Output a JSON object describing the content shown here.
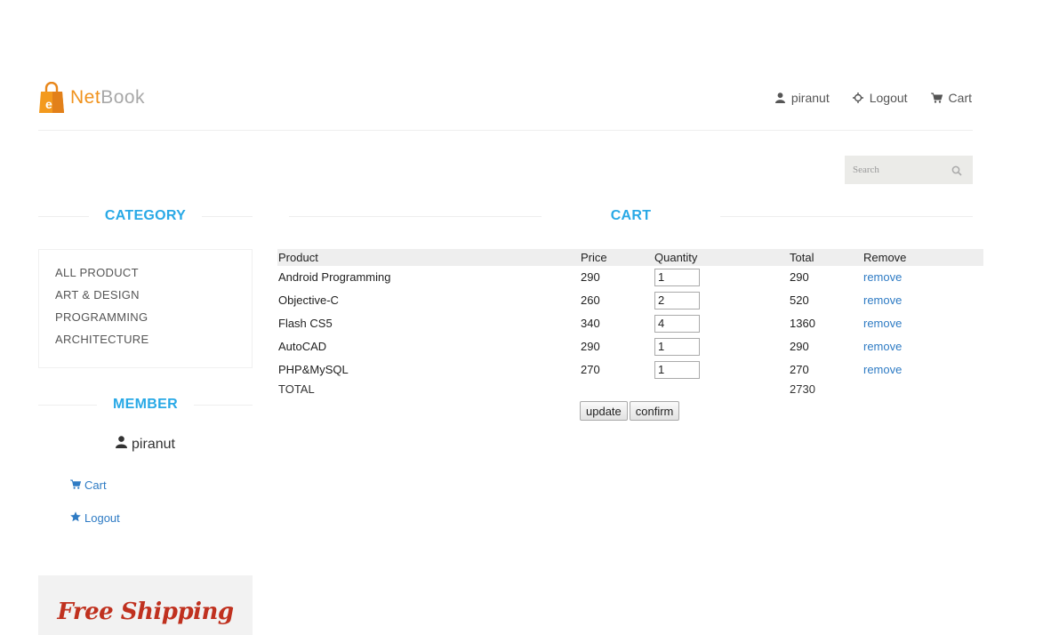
{
  "brand": {
    "part1": "Net",
    "part2": "Book",
    "bag_letter": "e"
  },
  "topnav": {
    "user": "piranut",
    "logout": "Logout",
    "cart": "Cart"
  },
  "search": {
    "placeholder": "Search"
  },
  "sidebar": {
    "category_title": "CATEGORY",
    "categories": [
      "ALL PRODUCT",
      "ART & DESIGN",
      "PROGRAMMING",
      "ARCHITECTURE"
    ],
    "member_title": "MEMBER",
    "member_user": "piranut",
    "member_cart": "Cart",
    "member_logout": "Logout",
    "promo": "Free Shipping"
  },
  "cart": {
    "title": "CART",
    "headers": {
      "product": "Product",
      "price": "Price",
      "quantity": "Quantity",
      "total": "Total",
      "remove": "Remove"
    },
    "rows": [
      {
        "product": "Android Programming",
        "price": "290",
        "qty": "1",
        "total": "290",
        "remove": "remove"
      },
      {
        "product": "Objective-C",
        "price": "260",
        "qty": "2",
        "total": "520",
        "remove": "remove"
      },
      {
        "product": "Flash CS5",
        "price": "340",
        "qty": "4",
        "total": "1360",
        "remove": "remove"
      },
      {
        "product": "AutoCAD",
        "price": "290",
        "qty": "1",
        "total": "290",
        "remove": "remove"
      },
      {
        "product": "PHP&MySQL",
        "price": "270",
        "qty": "1",
        "total": "270",
        "remove": "remove"
      }
    ],
    "total_label": "TOTAL",
    "total_value": "2730",
    "update_label": "update",
    "confirm_label": "confirm"
  },
  "colors": {
    "accent": "#29a9e6",
    "link": "#2e7bc4",
    "brand_orange": "#f0921c",
    "promo_red": "#c0311f"
  }
}
